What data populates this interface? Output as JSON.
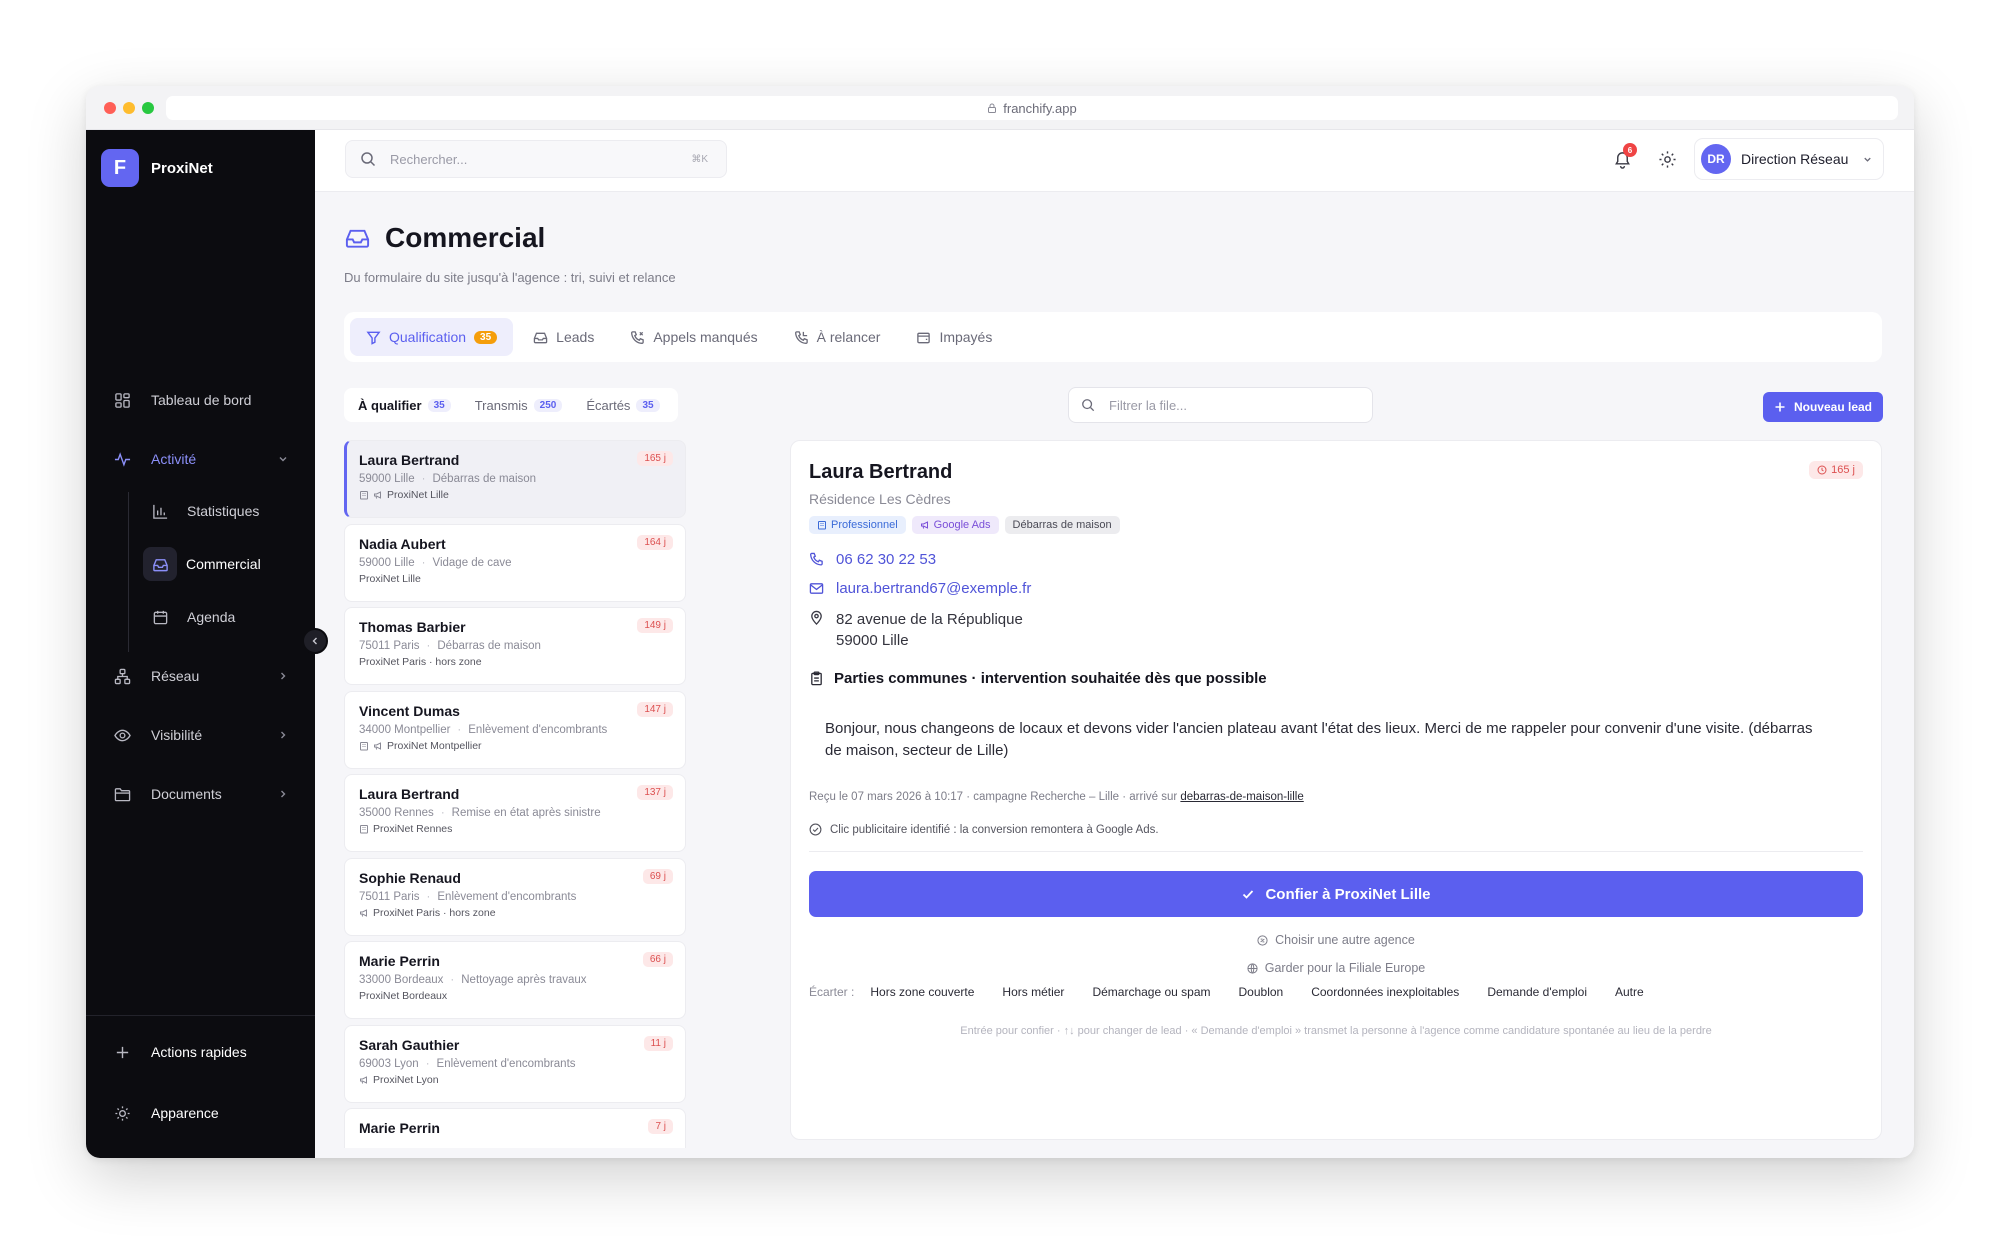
{
  "browser": {
    "url": "franchify.app"
  },
  "brand": {
    "logo_letter": "F",
    "name": "ProxiNet",
    "accent": "#6366f1"
  },
  "sidebar": {
    "items": [
      {
        "label": "Tableau de bord",
        "icon": "dashboard-icon"
      },
      {
        "label": "Activité",
        "icon": "activity-icon"
      },
      {
        "label": "Réseau",
        "icon": "network-icon"
      },
      {
        "label": "Visibilité",
        "icon": "eye-icon"
      },
      {
        "label": "Documents",
        "icon": "folder-icon"
      }
    ],
    "sub_items": [
      {
        "label": "Statistiques",
        "icon": "bar-chart-icon"
      },
      {
        "label": "Commercial",
        "icon": "inbox-icon"
      },
      {
        "label": "Agenda",
        "icon": "calendar-icon"
      }
    ],
    "quick_actions": "Actions rapides",
    "appearance": "Apparence"
  },
  "topbar": {
    "search_placeholder": "Rechercher...",
    "shortcut": "⌘K",
    "notifications_count": "6",
    "user_initials": "DR",
    "user_name": "Direction Réseau"
  },
  "page": {
    "title": "Commercial",
    "subtitle": "Du formulaire du site jusqu'à l'agence : tri, suivi et relance"
  },
  "tabs": [
    {
      "label": "Qualification",
      "badge": "35",
      "active": true
    },
    {
      "label": "Leads"
    },
    {
      "label": "Appels manqués"
    },
    {
      "label": "À relancer"
    },
    {
      "label": "Impayés"
    }
  ],
  "subtabs": [
    {
      "label": "À qualifier",
      "count": "35"
    },
    {
      "label": "Transmis",
      "count": "250"
    },
    {
      "label": "Écartés",
      "count": "35"
    }
  ],
  "filter_placeholder": "Filtrer la file...",
  "new_lead_label": "Nouveau lead",
  "leads": [
    {
      "name": "Laura Bertrand",
      "city": "59000 Lille",
      "service": "Débarras de maison",
      "agency": "ProxiNet Lille",
      "age": "165 j"
    },
    {
      "name": "Nadia Aubert",
      "city": "59000 Lille",
      "service": "Vidage de cave",
      "agency": "ProxiNet Lille",
      "age": "164 j"
    },
    {
      "name": "Thomas Barbier",
      "city": "75011 Paris",
      "service": "Débarras de maison",
      "agency": "ProxiNet Paris · hors zone",
      "age": "149 j"
    },
    {
      "name": "Vincent Dumas",
      "city": "34000 Montpellier",
      "service": "Enlèvement d'encombrants",
      "agency": "ProxiNet Montpellier",
      "age": "147 j"
    },
    {
      "name": "Laura Bertrand",
      "city": "35000 Rennes",
      "service": "Remise en état après sinistre",
      "agency": "ProxiNet Rennes",
      "age": "137 j"
    },
    {
      "name": "Sophie Renaud",
      "city": "75011 Paris",
      "service": "Enlèvement d'encombrants",
      "agency": "ProxiNet Paris · hors zone",
      "age": "69 j"
    },
    {
      "name": "Marie Perrin",
      "city": "33000 Bordeaux",
      "service": "Nettoyage après travaux",
      "agency": "ProxiNet Bordeaux",
      "age": "66 j"
    },
    {
      "name": "Sarah Gauthier",
      "city": "69003 Lyon",
      "service": "Enlèvement d'encombrants",
      "agency": "ProxiNet Lyon",
      "age": "11 j"
    },
    {
      "name": "Marie Perrin",
      "city": "",
      "service": "",
      "agency": "",
      "age": "7 j"
    }
  ],
  "detail": {
    "name": "Laura Bertrand",
    "residence": "Résidence Les Cèdres",
    "age": "165 j",
    "tags": [
      "Professionnel",
      "Google Ads",
      "Débarras de maison"
    ],
    "phone": "06 62 30 22 53",
    "email": "laura.bertrand67@exemple.fr",
    "address_line1": "82 avenue de la République",
    "address_line2": "59000 Lille",
    "subject": "Parties communes · intervention souhaitée dès que possible",
    "message": "Bonjour, nous changeons de locaux et devons vider l'ancien plateau avant l'état des lieux. Merci de me rappeler pour convenir d'une visite. (débarras de maison, secteur de Lille)",
    "received_prefix": "Reçu le 07 mars 2026 à 10:17 · campagne Recherche – Lille · arrivé sur ",
    "received_page": "debarras-de-maison-lille",
    "conversion_note": "Clic publicitaire identifié : la conversion remontera à Google Ads.",
    "confirm_label": "Confier à ProxiNet Lille",
    "alt_agency": "Choisir une autre agence",
    "keep_europe": "Garder pour la Filiale Europe",
    "discard_label": "Écarter :",
    "discard_reasons": [
      "Hors zone couverte",
      "Hors métier",
      "Démarchage ou spam",
      "Doublon",
      "Coordonnées inexploitables",
      "Demande d'emploi",
      "Autre"
    ],
    "hint": "Entrée pour confier · ↑↓ pour changer de lead · « Demande d'emploi » transmet la personne à l'agence comme candidature spontanée au lieu de la perdre"
  }
}
